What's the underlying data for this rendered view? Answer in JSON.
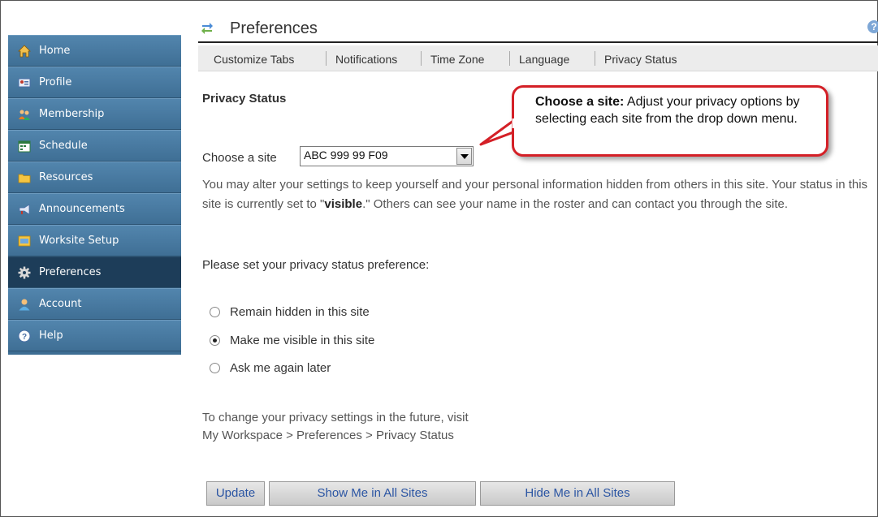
{
  "sidebar": {
    "items": [
      {
        "label": "Home",
        "icon": "home-icon"
      },
      {
        "label": "Profile",
        "icon": "profile-icon"
      },
      {
        "label": "Membership",
        "icon": "membership-icon"
      },
      {
        "label": "Schedule",
        "icon": "calendar-icon"
      },
      {
        "label": "Resources",
        "icon": "folder-icon"
      },
      {
        "label": "Announcements",
        "icon": "megaphone-icon"
      },
      {
        "label": "Worksite Setup",
        "icon": "worksite-setup-icon"
      },
      {
        "label": "Preferences",
        "icon": "gear-icon",
        "active": true
      },
      {
        "label": "Account",
        "icon": "account-icon"
      },
      {
        "label": "Help",
        "icon": "help-icon"
      }
    ]
  },
  "header": {
    "title": "Preferences",
    "help": "?"
  },
  "tabs": [
    "Customize Tabs",
    "Notifications",
    "Time Zone",
    "Language",
    "Privacy Status"
  ],
  "main": {
    "section_title": "Privacy Status",
    "choose_label": "Choose a site",
    "site_select": {
      "value": "ABC 999 99 F09"
    },
    "description_1": "You may alter your settings to keep yourself and your personal information hidden from others in this site. Your status in this site is currently set to \"",
    "description_bold": "visible",
    "description_2": ".\" Others can see your name in the roster and can contact you through the site.",
    "prompt": "Please set your privacy status preference:",
    "radios": [
      {
        "label": "Remain hidden in this site",
        "checked": false
      },
      {
        "label": "Make me visible in this site",
        "checked": true
      },
      {
        "label": "Ask me again later",
        "checked": false
      }
    ],
    "future_line1": "To change your privacy settings in the future, visit",
    "future_line2": "My Workspace > Preferences > Privacy Status"
  },
  "buttons": {
    "update": "Update",
    "show_all": "Show Me in All Sites",
    "hide_all": "Hide Me in All Sites"
  },
  "callout": {
    "title": "Choose a site:",
    "text": " Adjust your privacy options by selecting each site from the drop down menu."
  },
  "colors": {
    "sidebar": "#3d6d93",
    "sidebar_active": "#1d3d59",
    "callout_border": "#d42027",
    "button_text": "#2b55a3"
  }
}
